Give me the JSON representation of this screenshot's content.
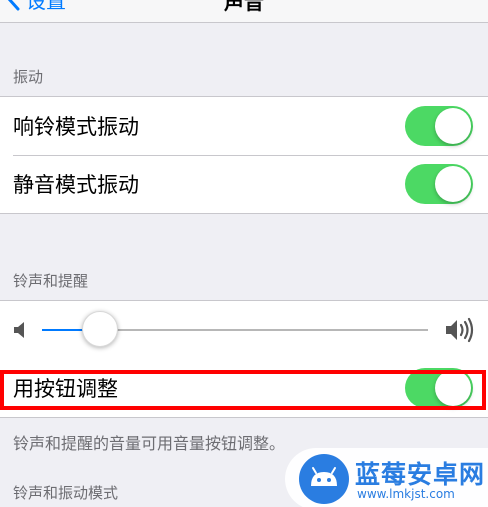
{
  "nav": {
    "back_label": "设置",
    "title": "声音"
  },
  "vibration_section": {
    "header": "振动",
    "rows": [
      {
        "label": "响铃模式振动",
        "toggle_on": true
      },
      {
        "label": "静音模式振动",
        "toggle_on": true
      }
    ]
  },
  "ringer_section": {
    "header": "铃声和提醒",
    "volume_level": 0.15,
    "change_with_buttons": {
      "label": "用按钮调整",
      "toggle_on": true
    },
    "footer": "铃声和提醒的音量可用音量按钮调整。"
  },
  "pattern_section": {
    "header": "铃声和振动模式"
  },
  "watermark": {
    "name": "蓝莓安卓网",
    "url": "www.lmkjst.com"
  },
  "colors": {
    "toggle_on": "#4cd964",
    "accent": "#007aff",
    "highlight": "#ff0000"
  }
}
